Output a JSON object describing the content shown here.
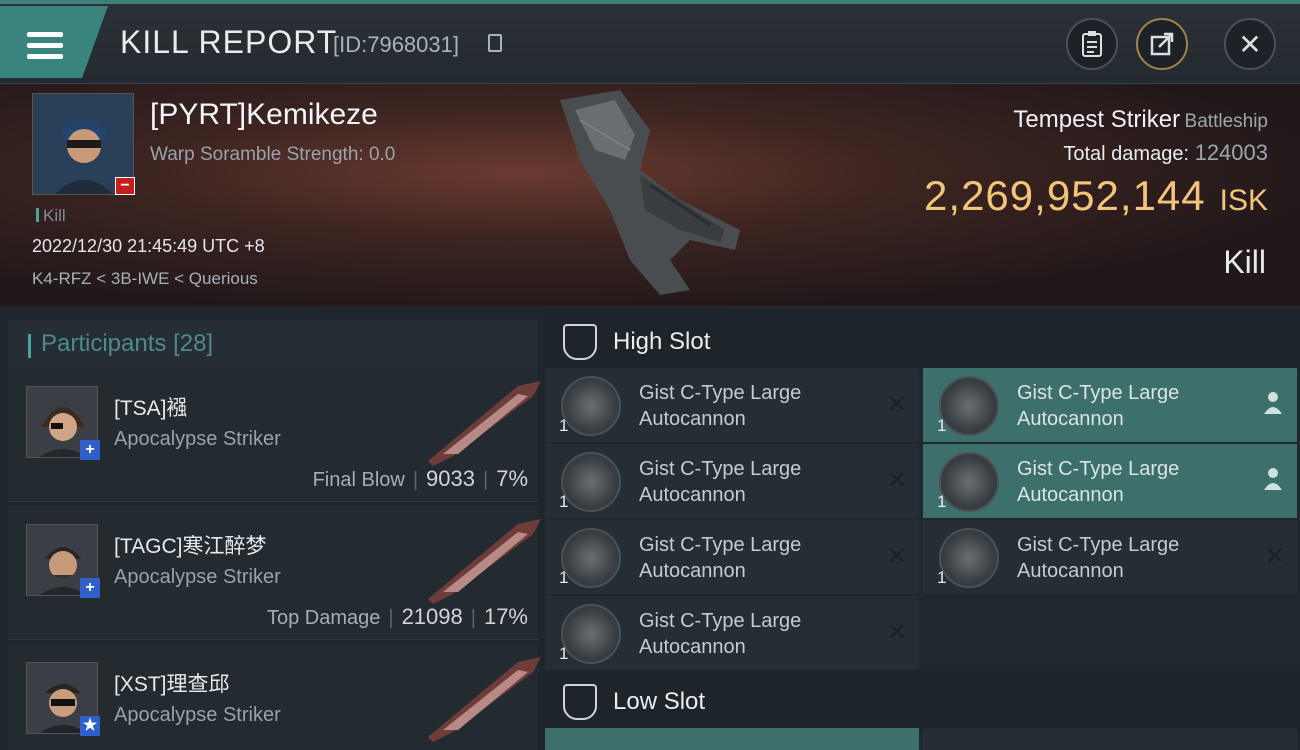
{
  "header": {
    "title": "KILL REPORT",
    "id_text": "[ID:7968031]"
  },
  "victim": {
    "name": "[PYRT]Kemikeze",
    "warp_scramble": "Warp Soramble Strength: 0.0",
    "kill_tag": "Kill",
    "datetime": "2022/12/30 21:45:49 UTC +8",
    "location": "K4-RFZ < 3B-IWE < Querious",
    "ship_name": "Tempest Striker",
    "ship_class": "Battleship",
    "total_damage_label": "Total damage:",
    "total_damage": "124003",
    "isk_value": "2,269,952,144",
    "isk_unit": "ISK",
    "result": "Kill"
  },
  "participants": {
    "title": "Participants",
    "count": "[28]",
    "items": [
      {
        "name": "[TSA]襁",
        "ship": "Apocalypse Striker",
        "stat_label": "Final Blow",
        "damage": "9033",
        "percent": "7%",
        "badge": "+"
      },
      {
        "name": "[TAGC]寒江醉梦",
        "ship": "Apocalypse Striker",
        "stat_label": "Top Damage",
        "damage": "21098",
        "percent": "17%",
        "badge": "+"
      },
      {
        "name": "[XST]理查邱",
        "ship": "Apocalypse Striker",
        "badge": "★"
      }
    ]
  },
  "slots": {
    "high": {
      "title": "High Slot",
      "modules": [
        {
          "name": "Gist C-Type Large Autocannon",
          "qty": "1"
        },
        {
          "name": "Gist C-Type Large Autocannon",
          "qty": "1"
        },
        {
          "name": "Gist C-Type Large Autocannon",
          "qty": "1"
        },
        {
          "name": "Gist C-Type Large Autocannon",
          "qty": "1"
        },
        {
          "name": "Gist C-Type Large Autocannon",
          "qty": "1"
        },
        {
          "name": "Gist C-Type Large Autocannon",
          "qty": "1"
        },
        {
          "name": "Gist C-Type Large Autocannon",
          "qty": "1"
        }
      ]
    },
    "low": {
      "title": "Low Slot"
    }
  },
  "icons": {
    "close": "✕",
    "remove": "✕"
  },
  "colors": {
    "accent_teal": "#3a8480",
    "isk_gold": "#f2c57a",
    "fitted_module": "#3d6f6b"
  }
}
